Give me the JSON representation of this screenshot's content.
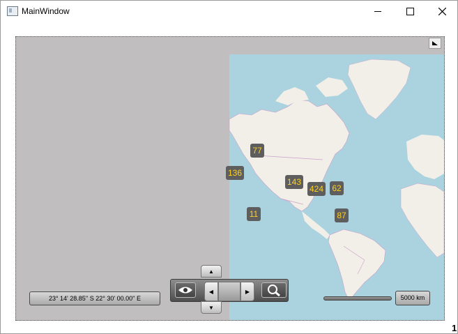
{
  "window": {
    "title": "MainWindow"
  },
  "map": {
    "clusters": [
      {
        "label": "77"
      },
      {
        "label": "136"
      },
      {
        "label": "143"
      },
      {
        "label": "424"
      },
      {
        "label": "62"
      },
      {
        "label": "11"
      },
      {
        "label": "87"
      }
    ],
    "coordinates": "23° 14' 28.85'' S 22° 30' 00.00'' E",
    "scale": "5000 km",
    "colors": {
      "ocean": "#aad3df",
      "land": "#f2efe9",
      "empty": "#c0bebf",
      "cluster_bg": "#5e5e5e",
      "cluster_text": "#ffd21f"
    }
  },
  "navigation": {
    "view_icon": "eye-icon",
    "zoom_icon": "magnifier-icon",
    "up_arrow": "▲",
    "down_arrow": "▼",
    "left_arrow": "◀",
    "right_arrow": "▶"
  },
  "footer": {
    "page_number": "1"
  }
}
